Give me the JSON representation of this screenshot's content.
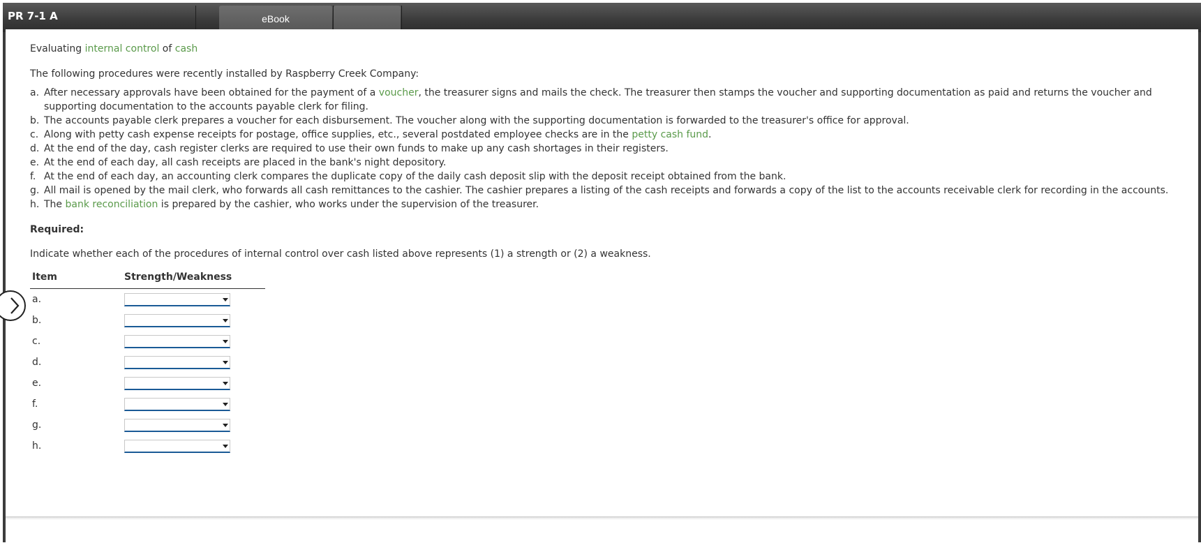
{
  "header": {
    "problem_title": "PR 7-1 A",
    "tabs": [
      {
        "label": "eBook"
      },
      {
        "label": ""
      }
    ]
  },
  "content": {
    "heading": {
      "prefix": "Evaluating ",
      "link1": "internal control",
      "middle": " of ",
      "link2": "cash"
    },
    "intro": "The following procedures were recently installed by Raspberry Creek Company:",
    "procedures": [
      {
        "letter": "a.",
        "before": "After necessary approvals have been obtained for the payment of a ",
        "link": "voucher",
        "after": ", the treasurer signs and mails the check. The treasurer then stamps the voucher and supporting documentation as paid and returns the voucher and supporting documentation to the accounts payable clerk for filing."
      },
      {
        "letter": "b.",
        "before": "The accounts payable clerk prepares a voucher for each disbursement. The voucher along with the supporting documentation is forwarded to the treasurer's office for approval.",
        "link": "",
        "after": ""
      },
      {
        "letter": "c.",
        "before": "Along with petty cash expense receipts for postage, office supplies, etc., several postdated employee checks are in the ",
        "link": "petty cash fund",
        "after": "."
      },
      {
        "letter": "d.",
        "before": "At the end of the day, cash register clerks are required to use their own funds to make up any cash shortages in their registers.",
        "link": "",
        "after": ""
      },
      {
        "letter": "e.",
        "before": "At the end of each day, all cash receipts are placed in the bank's night depository.",
        "link": "",
        "after": ""
      },
      {
        "letter": "f.",
        "before": "At the end of each day, an accounting clerk compares the duplicate copy of the daily cash deposit slip with the deposit receipt obtained from the bank.",
        "link": "",
        "after": ""
      },
      {
        "letter": "g.",
        "before": "All mail is opened by the mail clerk, who forwards all cash remittances to the cashier. The cashier prepares a listing of the cash receipts and forwards a copy of the list to the accounts receivable clerk for recording in the accounts.",
        "link": "",
        "after": ""
      },
      {
        "letter": "h.",
        "before": "The ",
        "link": "bank reconciliation",
        "after": " is prepared by the cashier, who works under the supervision of the treasurer."
      }
    ],
    "required_label": "Required:",
    "instruction": "Indicate whether each of the procedures of internal control over cash listed above represents (1) a strength or (2) a weakness.",
    "table": {
      "headers": {
        "item": "Item",
        "strength_weakness": "Strength/Weakness"
      },
      "rows": [
        {
          "item": "a.",
          "selected": ""
        },
        {
          "item": "b.",
          "selected": ""
        },
        {
          "item": "c.",
          "selected": ""
        },
        {
          "item": "d.",
          "selected": ""
        },
        {
          "item": "e.",
          "selected": ""
        },
        {
          "item": "f.",
          "selected": ""
        },
        {
          "item": "g.",
          "selected": ""
        },
        {
          "item": "h.",
          "selected": ""
        }
      ]
    }
  },
  "icons": {
    "side_nav": "chevron-right-icon"
  },
  "colors": {
    "link_green": "#5a9a4a",
    "select_underline": "#1a5a96",
    "topbar": "#3c3c3c"
  }
}
